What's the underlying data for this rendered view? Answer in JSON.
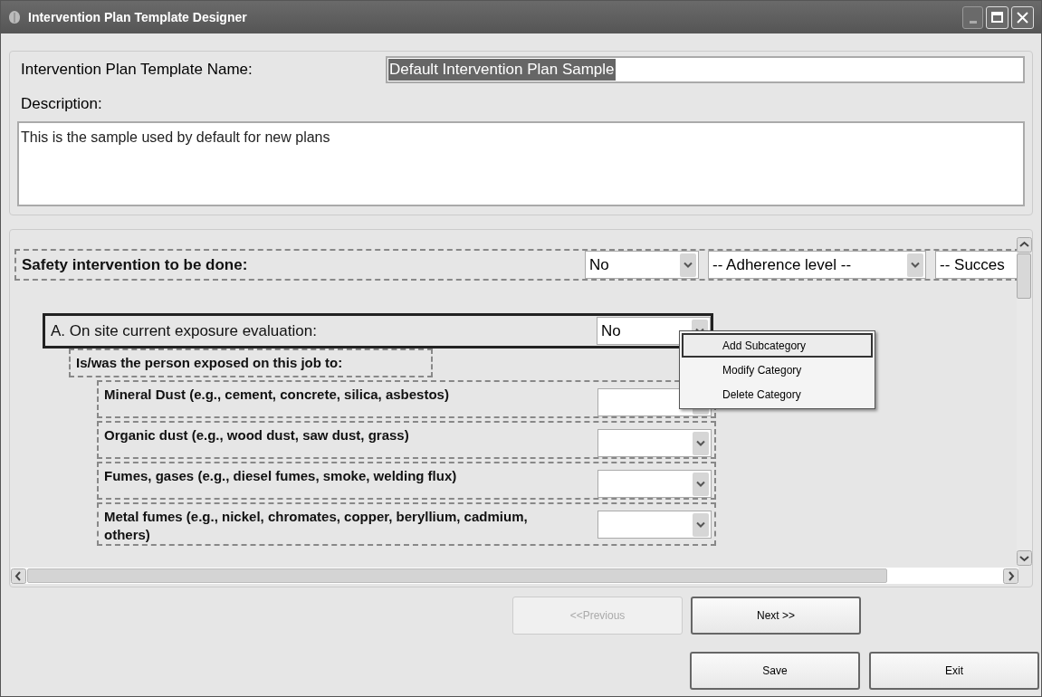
{
  "window": {
    "title": "Intervention Plan Template Designer"
  },
  "template_name": {
    "label": "Intervention Plan Template Name:",
    "value": "Default Intervention Plan Sample",
    "text_selected": true
  },
  "description": {
    "label": "Description:",
    "value": "This is the sample used by default for new plans"
  },
  "categories": [
    {
      "kind": "header",
      "label": "Safety intervention to be done:",
      "selected": false,
      "dropdowns": [
        {
          "value": "No"
        },
        {
          "value": "-- Adherence level --"
        },
        {
          "value": "-- Succes"
        }
      ],
      "children": [
        {
          "kind": "category",
          "label": "A. On site current exposure evaluation:",
          "selected": true,
          "dropdowns": [
            {
              "value": "No"
            }
          ],
          "children": [
            {
              "kind": "question",
              "label": "Is/was the person exposed on this job to:",
              "selected": false,
              "children": [
                {
                  "kind": "item",
                  "label": "Mineral Dust (e.g., cement, concrete, silica, asbestos)",
                  "selected": false,
                  "has_dropdown": true
                },
                {
                  "kind": "item",
                  "label": "Organic dust (e.g., wood dust, saw dust, grass)",
                  "selected": false,
                  "has_dropdown": true
                },
                {
                  "kind": "item",
                  "label": "Fumes, gases (e.g., diesel fumes, smoke, welding flux)",
                  "selected": false,
                  "has_dropdown": true
                },
                {
                  "kind": "item",
                  "label": "Metal fumes (e.g., nickel, chromates, copper, beryllium, cadmium, others)",
                  "selected": false,
                  "has_dropdown": true
                }
              ]
            }
          ]
        }
      ]
    }
  ],
  "context_menu": [
    {
      "label": "Add Subcategory",
      "selected": true
    },
    {
      "label": "Modify Category",
      "selected": false
    },
    {
      "label": "Delete Category",
      "selected": false
    }
  ],
  "nav_buttons": [
    {
      "label": "<<Previous",
      "disabled": true
    },
    {
      "label": "Next >>",
      "disabled": false
    }
  ],
  "action_buttons": [
    {
      "label": "Save",
      "disabled": false
    },
    {
      "label": "Exit",
      "disabled": false
    }
  ]
}
